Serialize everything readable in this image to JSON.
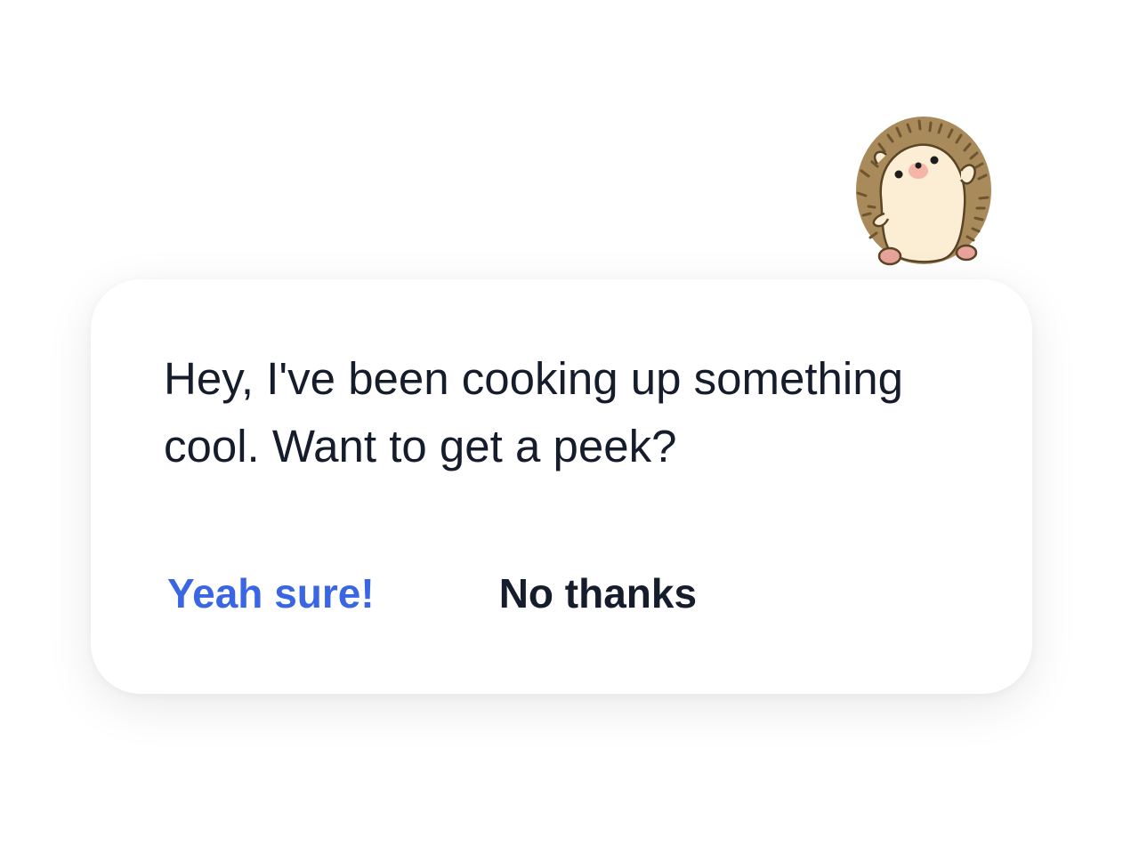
{
  "dialog": {
    "message": "Hey, I've been cooking up something cool. Want to get a peek?",
    "accept_label": "Yeah sure!",
    "decline_label": "No thanks"
  },
  "mascot": {
    "icon": "hedgehog-icon"
  },
  "colors": {
    "accent": "#3b66e3",
    "text": "#151c2c",
    "card_background": "#ffffff"
  }
}
